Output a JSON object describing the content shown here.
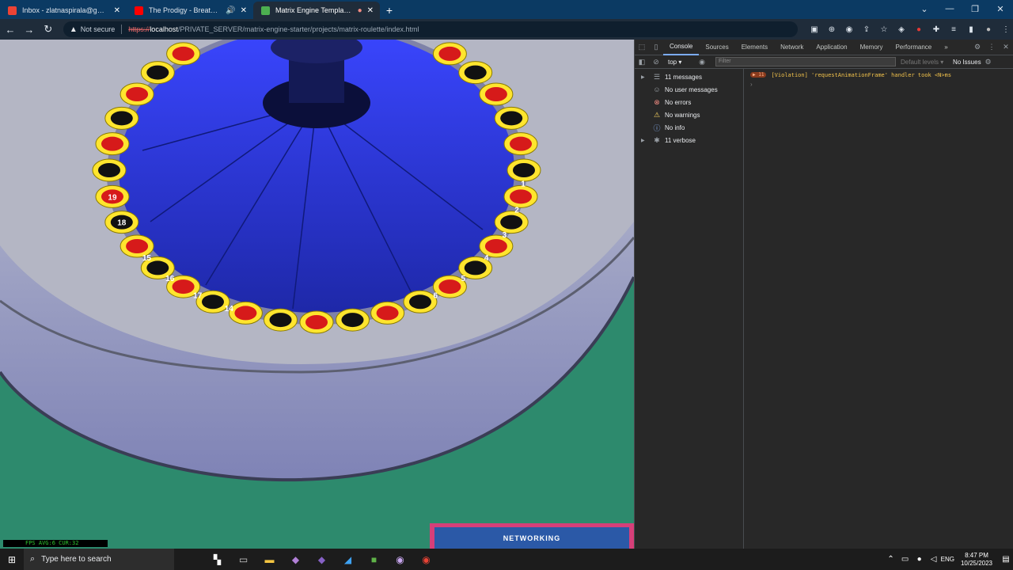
{
  "browser": {
    "tabs": [
      {
        "title": "Inbox - zlatnaspirala@gmail.com",
        "favicon_color": "#ea4335",
        "icon": "gmail-icon"
      },
      {
        "title": "The Prodigy - Breathe (Official",
        "favicon_color": "#ff0000",
        "icon": "youtube-icon"
      },
      {
        "title": "Matrix Engine Template - Pl",
        "favicon_color": "#4caf50",
        "icon": "matrix-engine-icon"
      }
    ],
    "new_tab": "+",
    "address": {
      "security": "Not secure",
      "protocol": "https://",
      "host": "localhost",
      "path": "/PRIVATE_SERVER/matrix-engine-starter/projects/matrix-roulette/index.html"
    }
  },
  "page": {
    "roulette_numbers": [
      "15",
      "16",
      "17",
      "18",
      "19",
      "14",
      "3",
      "4",
      "5",
      "6",
      "2",
      "1"
    ],
    "fps_text": "FPS AVG:6 CUR:32",
    "networking_button": "NETWORKING"
  },
  "devtools": {
    "tabs": [
      "Console",
      "Sources",
      "Elements",
      "Network",
      "Application",
      "Memory",
      "Performance"
    ],
    "more": "»",
    "context": "top",
    "filter_placeholder": "Filter",
    "levels": "Default levels",
    "issues": "No Issues",
    "sidebar": [
      {
        "label": "11 messages",
        "icon": "list-icon",
        "expandable": true
      },
      {
        "label": "No user messages",
        "icon": "user-icon",
        "expandable": false
      },
      {
        "label": "No errors",
        "icon": "error-icon",
        "expandable": false
      },
      {
        "label": "No warnings",
        "icon": "warning-icon",
        "expandable": false
      },
      {
        "label": "No info",
        "icon": "info-icon",
        "expandable": false
      },
      {
        "label": "11 verbose",
        "icon": "bug-icon",
        "expandable": true
      }
    ],
    "log": {
      "count": "11",
      "message": "[Violation] 'requestAnimationFrame' handler took <N>ms"
    },
    "prompt": "›"
  },
  "taskbar": {
    "search_placeholder": "Type here to search",
    "language": "ENG",
    "time": "8:47 PM",
    "date": "10/25/2023"
  },
  "colors": {
    "tabstrip": "#0b3a63",
    "floor": "#2d8a6d",
    "felt": "#2a36d4",
    "rim": "#9aa0b8",
    "pocket_ring": "#ffe52e",
    "net_panel": "#d63f79",
    "net_button": "#2b59a7"
  }
}
